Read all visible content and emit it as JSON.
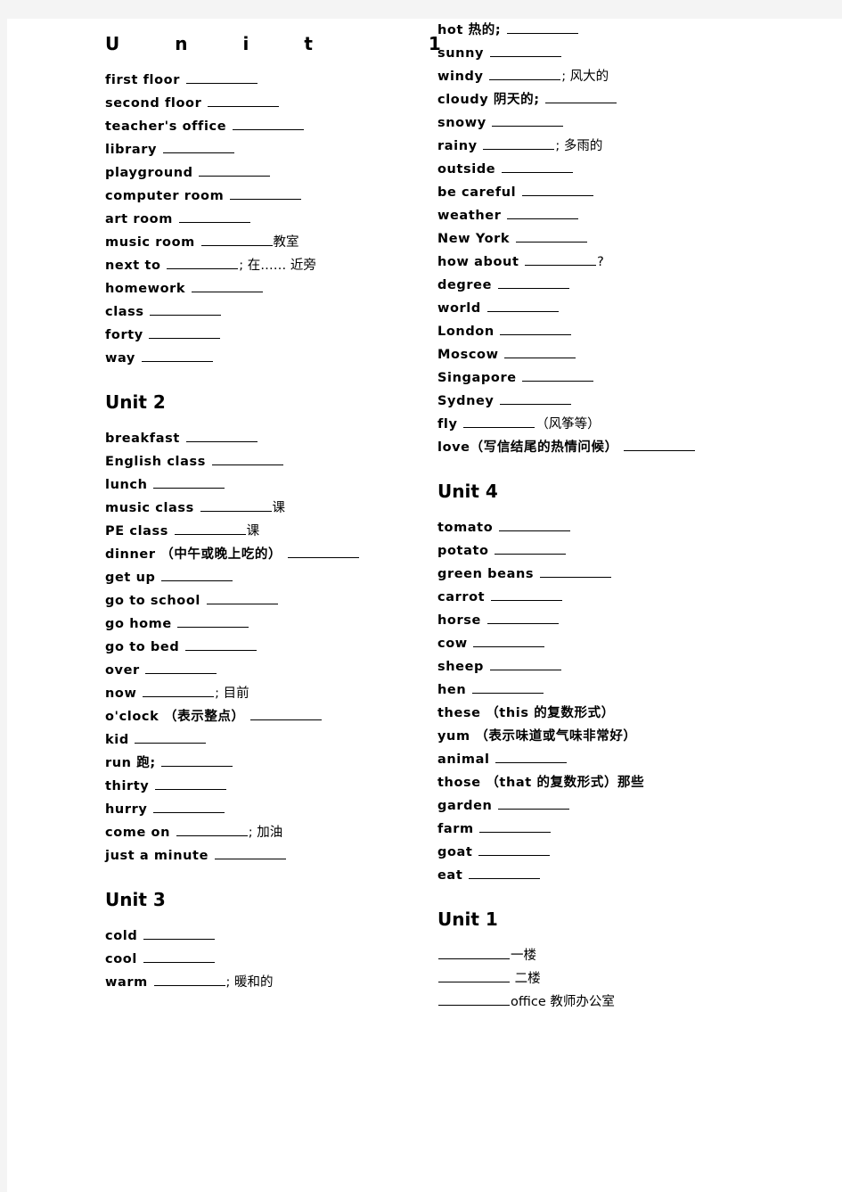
{
  "page": {
    "background": "#ffffff",
    "surround": "#f4f4f4",
    "ink": "#000000"
  },
  "left_column": {
    "sections": [
      {
        "heading": "Unit     1",
        "heading_spread": true,
        "entries": [
          {
            "term": "first floor",
            "blank": "md",
            "tail": ""
          },
          {
            "term": "second floor",
            "blank": "md",
            "tail": ""
          },
          {
            "term": "teacher's office",
            "blank": "md",
            "tail": ""
          },
          {
            "term": "library",
            "blank": "md",
            "tail": ""
          },
          {
            "term": "playground",
            "blank": "md",
            "tail": ""
          },
          {
            "term": "computer room",
            "blank": "md",
            "tail": ""
          },
          {
            "term": "art room",
            "blank": "md",
            "tail": ""
          },
          {
            "term": "music room",
            "blank": "md",
            "tail": "教室"
          },
          {
            "term": "next to",
            "blank": "md",
            "tail": "; 在…… 近旁"
          },
          {
            "term": "homework",
            "blank": "md",
            "tail": ""
          },
          {
            "term": "class",
            "blank": "md",
            "tail": ""
          },
          {
            "term": "forty",
            "blank": "md",
            "tail": ""
          },
          {
            "term": "way",
            "blank": "md",
            "tail": ""
          }
        ]
      },
      {
        "heading": "Unit 2",
        "heading_spread": false,
        "entries": [
          {
            "term": "breakfast",
            "blank": "md",
            "tail": ""
          },
          {
            "term": "English class",
            "blank": "md",
            "tail": ""
          },
          {
            "term": "lunch",
            "blank": "md",
            "tail": ""
          },
          {
            "term": "music class",
            "blank": "md",
            "tail": "课"
          },
          {
            "term": "PE class",
            "blank": "md",
            "tail": "课"
          },
          {
            "term": "dinner （中午或晚上吃的）",
            "blank": "md",
            "tail": ""
          },
          {
            "term": "get up",
            "blank": "md",
            "tail": ""
          },
          {
            "term": "go to school",
            "blank": "md",
            "tail": ""
          },
          {
            "term": "go home",
            "blank": "md",
            "tail": ""
          },
          {
            "term": "go to bed",
            "blank": "md",
            "tail": ""
          },
          {
            "term": "over",
            "blank": "md",
            "tail": ""
          },
          {
            "term": "now",
            "blank": "md",
            "tail": "; 目前"
          },
          {
            "term": "o'clock （表示整点）",
            "blank": "md",
            "tail": ""
          },
          {
            "term": "kid",
            "blank": "md",
            "tail": ""
          },
          {
            "term": "run 跑;",
            "blank": "md",
            "tail": ""
          },
          {
            "term": "thirty",
            "blank": "md",
            "tail": ""
          },
          {
            "term": "hurry",
            "blank": "md",
            "tail": ""
          },
          {
            "term": "come on",
            "blank": "md",
            "tail": "; 加油"
          },
          {
            "term": "just a minute",
            "blank": "md",
            "tail": ""
          }
        ]
      },
      {
        "heading": "Unit 3",
        "heading_spread": false,
        "entries": [
          {
            "term": "cold",
            "blank": "md",
            "tail": ""
          },
          {
            "term": "cool",
            "blank": "md",
            "tail": ""
          },
          {
            "term": "warm",
            "blank": "md",
            "tail": "; 暖和的"
          }
        ]
      }
    ]
  },
  "right_column": {
    "sections": [
      {
        "heading": "",
        "heading_spread": false,
        "entries": [
          {
            "term": "hot 热的;",
            "blank": "md",
            "tail": ""
          },
          {
            "term": "sunny",
            "blank": "md",
            "tail": ""
          },
          {
            "term": "windy",
            "blank": "md",
            "tail": "; 风大的"
          },
          {
            "term": "cloudy 阴天的;",
            "blank": "md",
            "tail": ""
          },
          {
            "term": "snowy",
            "blank": "md",
            "tail": ""
          },
          {
            "term": "rainy",
            "blank": "md",
            "tail": "; 多雨的"
          },
          {
            "term": "outside",
            "blank": "md",
            "tail": ""
          },
          {
            "term": "be careful",
            "blank": "md",
            "tail": ""
          },
          {
            "term": "weather",
            "blank": "md",
            "tail": ""
          },
          {
            "term": "New York",
            "blank": "md",
            "tail": ""
          },
          {
            "term": "how about",
            "blank": "md",
            "tail": "?"
          },
          {
            "term": "degree",
            "blank": "md",
            "tail": ""
          },
          {
            "term": "world",
            "blank": "md",
            "tail": ""
          },
          {
            "term": "London",
            "blank": "md",
            "tail": ""
          },
          {
            "term": "Moscow",
            "blank": "md",
            "tail": ""
          },
          {
            "term": "Singapore",
            "blank": "md",
            "tail": ""
          },
          {
            "term": "Sydney",
            "blank": "md",
            "tail": ""
          },
          {
            "term": "fly",
            "blank": "md",
            "tail": "（风筝等）"
          },
          {
            "term": "love（写信结尾的热情问候）",
            "blank": "md",
            "tail": ""
          }
        ]
      },
      {
        "heading": "Unit 4",
        "heading_spread": false,
        "entries": [
          {
            "term": "tomato",
            "blank": "md",
            "tail": ""
          },
          {
            "term": "potato",
            "blank": "md",
            "tail": ""
          },
          {
            "term": "green beans",
            "blank": "md",
            "tail": ""
          },
          {
            "term": "carrot",
            "blank": "md",
            "tail": ""
          },
          {
            "term": "horse",
            "blank": "md",
            "tail": ""
          },
          {
            "term": "cow",
            "blank": "md",
            "tail": ""
          },
          {
            "term": "sheep",
            "blank": "md",
            "tail": ""
          },
          {
            "term": "hen",
            "blank": "md",
            "tail": ""
          },
          {
            "term": "these （this 的复数形式）",
            "blank": "none",
            "tail": ""
          },
          {
            "term": "yum （表示味道或气味非常好）",
            "blank": "none",
            "tail": ""
          },
          {
            "term": "animal",
            "blank": "md",
            "tail": ""
          },
          {
            "term": "those （that 的复数形式）那些",
            "blank": "none",
            "tail": ""
          },
          {
            "term": "garden",
            "blank": "md",
            "tail": ""
          },
          {
            "term": "farm",
            "blank": "md",
            "tail": ""
          },
          {
            "term": "goat",
            "blank": "md",
            "tail": ""
          },
          {
            "term": "eat",
            "blank": "md",
            "tail": ""
          }
        ]
      },
      {
        "heading": "Unit 1",
        "heading_spread": false,
        "entries": [
          {
            "term": "",
            "blank": "md",
            "tail": "一楼"
          },
          {
            "term": "",
            "blank": "md",
            "tail": " 二楼"
          },
          {
            "term": "",
            "blank": "md",
            "tail": "office 教师办公室"
          }
        ]
      }
    ]
  }
}
